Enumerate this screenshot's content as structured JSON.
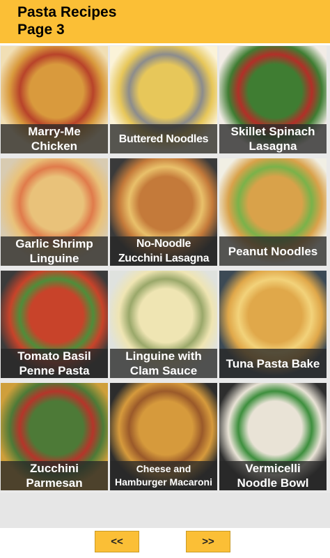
{
  "header": {
    "line1": "Pasta Recipes",
    "line2": "Page 3"
  },
  "recipes": [
    {
      "label": "Marry-Me\nChicken",
      "photo": [
        "#f1dfb5",
        "#d99a3d",
        "#b8432a"
      ]
    },
    {
      "label": "Buttered Noodles",
      "photo": [
        "#fbf3d8",
        "#e7c75a",
        "#8c8c8c"
      ]
    },
    {
      "label": "Skillet Spinach\nLasagna",
      "photo": [
        "#f2ece6",
        "#3f7d32",
        "#b22f28"
      ]
    },
    {
      "label": "Garlic Shrimp\nLinguine",
      "photo": [
        "#d8cbb1",
        "#e9c27a",
        "#e07b4b"
      ]
    },
    {
      "label": "No-Noodle\nZucchini Lasagna",
      "photo": [
        "#3a3a3a",
        "#c47a3a",
        "#e9c06a"
      ]
    },
    {
      "label": "Peanut Noodles",
      "photo": [
        "#f1efe4",
        "#d9a24a",
        "#7ab24a"
      ]
    },
    {
      "label": "Tomato Basil\nPenne Pasta",
      "photo": [
        "#3b3b3b",
        "#c8432a",
        "#4f8d3a"
      ]
    },
    {
      "label": "Linguine with\nClam Sauce",
      "photo": [
        "#dfe2de",
        "#efe5b3",
        "#9aa86a"
      ]
    },
    {
      "label": "Tuna Pasta Bake",
      "photo": [
        "#3c4a55",
        "#e0a84a",
        "#f2d27a"
      ]
    },
    {
      "label": "Zucchini\nParmesan",
      "photo": [
        "#cf9f3b",
        "#4d7a37",
        "#b5352a"
      ]
    },
    {
      "label": "Cheese and\nHamburger Macaroni",
      "photo": [
        "#2d2d2d",
        "#d69a3c",
        "#9b5a2a"
      ]
    },
    {
      "label": "Vermicelli\nNoodle Bowl",
      "photo": [
        "#2e2e2e",
        "#e9e3d6",
        "#3d8f3d"
      ]
    }
  ],
  "nav": {
    "prev": "<<",
    "next": ">>"
  }
}
